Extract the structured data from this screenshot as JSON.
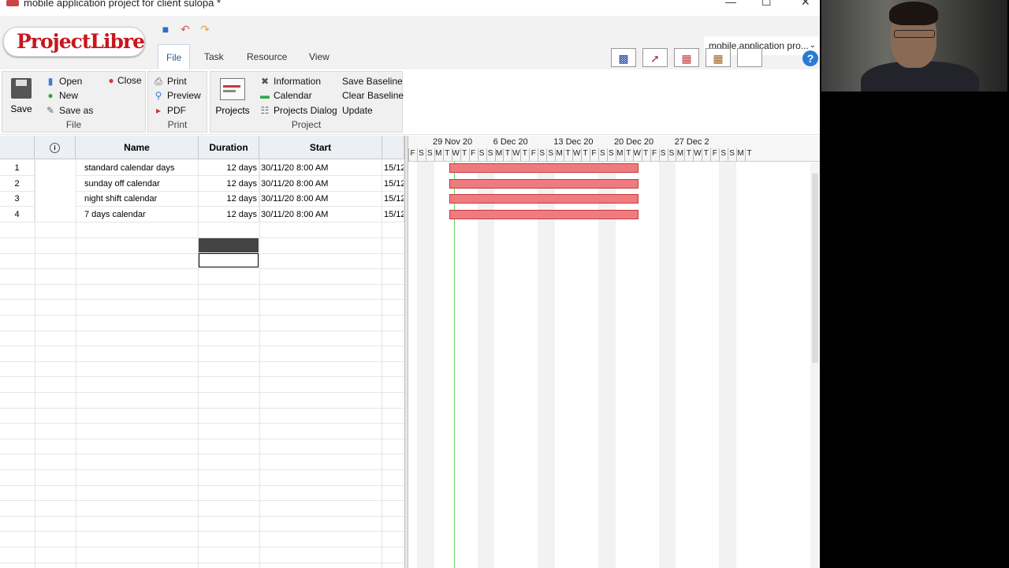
{
  "window": {
    "title": "mobile application project for client sulopa *",
    "controls": [
      "—",
      "☐",
      "✕"
    ]
  },
  "header": {
    "logo": "ProjectLibre",
    "tabs": [
      "File",
      "Task",
      "Resource",
      "View"
    ],
    "active_tab": "File",
    "project_selector": "mobile application pro..."
  },
  "ribbon": {
    "file_group": {
      "label": "File",
      "save": "Save",
      "open": "Open",
      "close": "Close",
      "new": "New",
      "save_as": "Save as"
    },
    "print_group": {
      "label": "Print",
      "print": "Print",
      "preview": "Preview",
      "pdf": "PDF"
    },
    "project_group": {
      "label": "Project",
      "projects": "Projects",
      "information": "Information",
      "calendar": "Calendar",
      "projects_dialog": "Projects Dialog",
      "save_baseline": "Save Baseline",
      "clear_baseline": "Clear Baseline",
      "update": "Update"
    }
  },
  "grid": {
    "columns": {
      "name": "Name",
      "duration": "Duration",
      "start": "Start"
    },
    "rows": [
      {
        "id": "1",
        "name": "standard calendar days",
        "duration": "12 days",
        "start": "30/11/20 8:00 AM",
        "finish": "15/12"
      },
      {
        "id": "2",
        "name": "sunday off calendar",
        "duration": "12 days",
        "start": "30/11/20 8:00 AM",
        "finish": "15/12"
      },
      {
        "id": "3",
        "name": "night shift calendar",
        "duration": "12 days",
        "start": "30/11/20 8:00 AM",
        "finish": "15/12"
      },
      {
        "id": "4",
        "name": "7 days calendar",
        "duration": "12 days",
        "start": "30/11/20 8:00 AM",
        "finish": "15/12"
      }
    ]
  },
  "gantt": {
    "weeks": [
      "29 Nov 20",
      "6 Dec 20",
      "13 Dec 20",
      "20 Dec 20",
      "27 Dec 2"
    ],
    "day_letters": [
      "F",
      "S",
      "S",
      "M",
      "T",
      "W",
      "T",
      "F",
      "S",
      "S",
      "M",
      "T",
      "W",
      "T",
      "F",
      "S",
      "S",
      "M",
      "T",
      "W",
      "T",
      "F",
      "S",
      "S",
      "M",
      "T",
      "W",
      "T",
      "F",
      "S",
      "S",
      "M",
      "T",
      "W",
      "T",
      "F",
      "S",
      "S",
      "M",
      "T"
    ]
  },
  "colors": {
    "bar": "#f07b7f",
    "bar_border": "#c43a3e",
    "logo_red": "#c8161d",
    "accent_blue": "#2c5a96"
  }
}
